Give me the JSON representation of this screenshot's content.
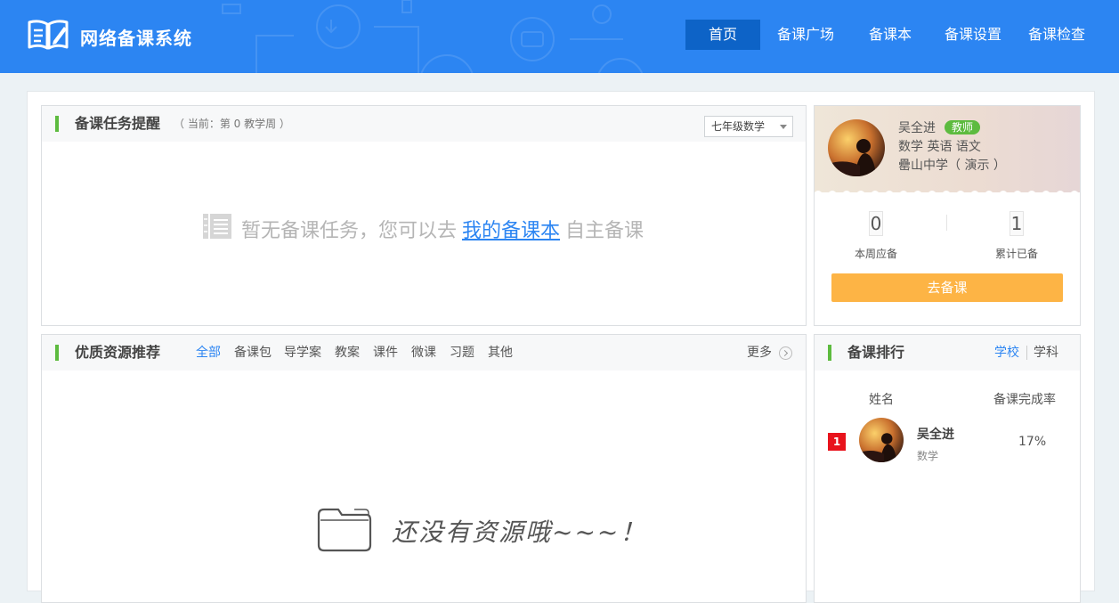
{
  "header": {
    "logo_text": "网络备课系统",
    "nav": [
      {
        "label": "首页",
        "active": true
      },
      {
        "label": "备课广场"
      },
      {
        "label": "备课本"
      },
      {
        "label": "备课设置"
      },
      {
        "label": "备课检查"
      }
    ]
  },
  "tasks": {
    "title": "备课任务提醒",
    "subtitle": "（ 当前：第 0 教学周 ）",
    "grade_select": "七年级数学",
    "empty_prefix": "暂无备课任务，您可以去",
    "empty_link": "我的备课本",
    "empty_suffix": "自主备课"
  },
  "profile": {
    "name": "吴全进",
    "badge": "教师",
    "subjects": "数学 英语 语文",
    "school": "罍山中学（ 演示 ）",
    "weekly_due_value": "0",
    "weekly_due_label": "本周应备",
    "total_done_value": "1",
    "total_done_label": "累计已备",
    "go_button": "去备课"
  },
  "resources": {
    "title": "优质资源推荐",
    "tabs": [
      "全部",
      "备课包",
      "导学案",
      "教案",
      "课件",
      "微课",
      "习题",
      "其他"
    ],
    "active_tab": "全部",
    "more": "更多",
    "empty_text": "还没有资源哦~~~！"
  },
  "ranking": {
    "title": "备课排行",
    "tabs": [
      "学校",
      "学科"
    ],
    "active_tab": "学校",
    "col_name": "姓名",
    "col_rate": "备课完成率",
    "rows": [
      {
        "rank": "1",
        "name": "吴全进",
        "subject": "数学",
        "rate": "17%"
      }
    ]
  },
  "colors": {
    "primary": "#2c85f2",
    "nav_active": "#0d63c7",
    "accent_green": "#5dbb3f",
    "button_orange": "#fdb445",
    "rank_red": "#e8131c"
  }
}
